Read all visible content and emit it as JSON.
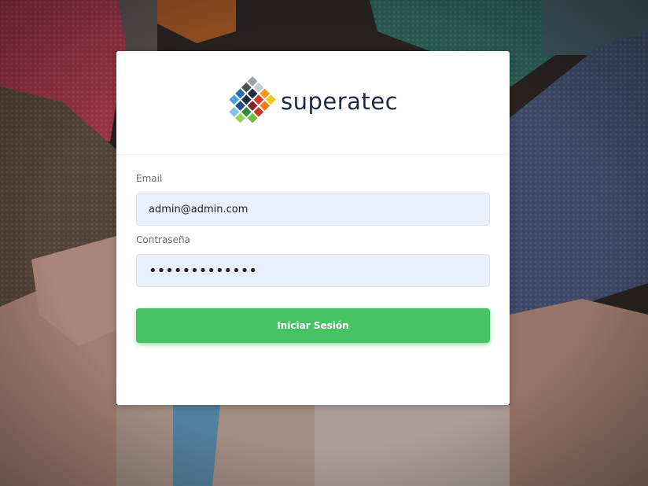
{
  "brand": {
    "name": "superatec",
    "text_color": "#1f2a44"
  },
  "form": {
    "email_label": "Email",
    "email_value": "admin@admin.com",
    "password_label": "Contraseña",
    "password_value": "•••••••••••••",
    "submit_label": "Iniciar Sesión"
  },
  "colors": {
    "accent": "#47c363",
    "field_bg": "#e8f0fe"
  },
  "icons": {
    "logo": "superatec-logo-icon",
    "background": "hands-together-photo"
  }
}
